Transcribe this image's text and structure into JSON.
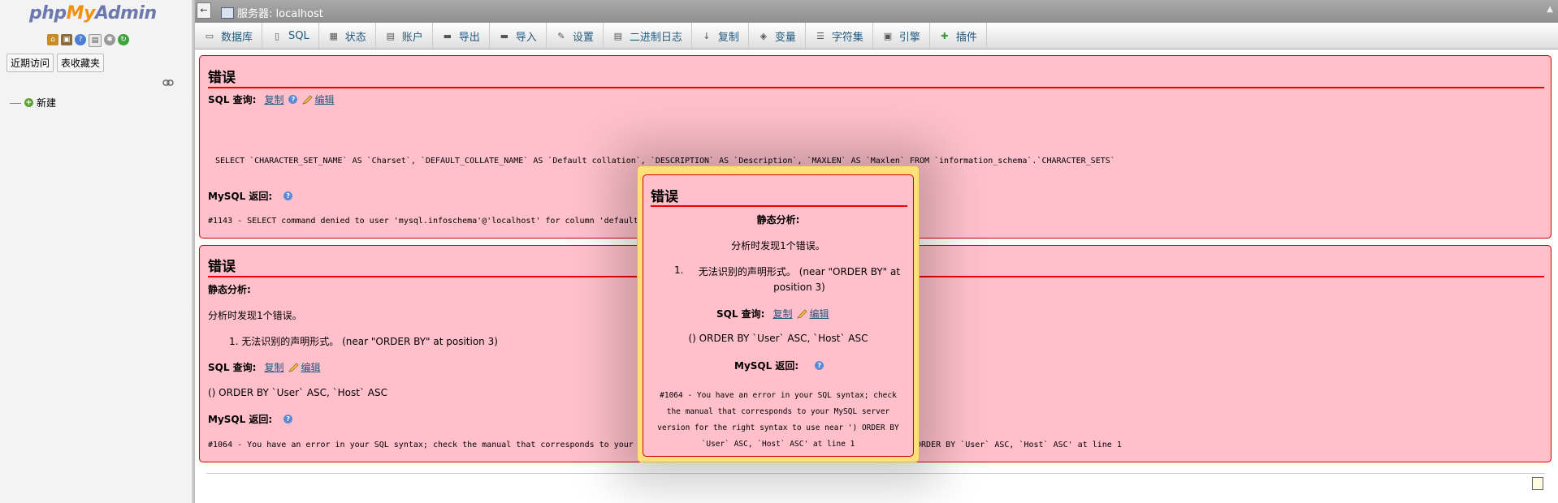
{
  "nav": {
    "logo": {
      "php": "php",
      "my": "My",
      "admin": "Admin"
    },
    "tabs": [
      "近期访问",
      "表收藏夹"
    ],
    "new_label": "新建"
  },
  "topbar": {
    "title": "服务器: localhost"
  },
  "menu": [
    {
      "label": "数据库",
      "icon": "database-icon"
    },
    {
      "label": "SQL",
      "icon": "sql-icon"
    },
    {
      "label": "状态",
      "icon": "status-icon"
    },
    {
      "label": "账户",
      "icon": "accounts-icon"
    },
    {
      "label": "导出",
      "icon": "export-icon"
    },
    {
      "label": "导入",
      "icon": "import-icon"
    },
    {
      "label": "设置",
      "icon": "settings-icon"
    },
    {
      "label": "二进制日志",
      "icon": "binlog-icon"
    },
    {
      "label": "复制",
      "icon": "replication-icon"
    },
    {
      "label": "变量",
      "icon": "variables-icon"
    },
    {
      "label": "字符集",
      "icon": "charset-icon"
    },
    {
      "label": "引擎",
      "icon": "engine-icon"
    },
    {
      "label": "插件",
      "icon": "plugin-icon"
    }
  ],
  "error1": {
    "title": "错误",
    "sql_label": "SQL 查询:",
    "copy": "复制",
    "edit": "编辑",
    "query": "SELECT `CHARACTER_SET_NAME` AS `Charset`, `DEFAULT_COLLATE_NAME` AS `Default collation`, `DESCRIPTION` AS `Description`, `MAXLEN` AS `Maxlen` FROM `information_schema`.`CHARACTER_SETS`",
    "mysql_label": "MySQL 返回:",
    "message": "#1143 - SELECT command denied to user 'mysql.infoschema'@'localhost' for column 'default"
  },
  "error2": {
    "title": "错误",
    "static_label": "静态分析:",
    "found": "分析时发现1个错误。",
    "item": "1. 无法识别的声明形式。 (near \"ORDER BY\" at position 3)",
    "sql_label": "SQL 查询:",
    "copy": "复制",
    "edit": "编辑",
    "query": "() ORDER BY `User` ASC, `Host` ASC",
    "mysql_label": "MySQL 返回:",
    "message_left": "#1064 - You have an error in your SQL syntax; check the manual that corresponds to your",
    "message_right": "ORDER BY `User` ASC, `Host` ASC' at line 1"
  },
  "popup": {
    "title": "错误",
    "static_label": "静态分析:",
    "found": "分析时发现1个错误。",
    "item_num": "1.",
    "item_text_1": "无法识别的声明形式。 (near \"ORDER BY\" at",
    "item_text_2": "position 3)",
    "sql_label": "SQL 查询:",
    "copy": "复制",
    "edit": "编辑",
    "query": "() ORDER BY `User` ASC, `Host` ASC",
    "mysql_label": "MySQL 返回:",
    "message_lines": [
      "#1064 - You have an error in your SQL syntax; check",
      "the manual that corresponds to your MySQL server",
      "version for the right syntax to use near ') ORDER BY",
      "`User` ASC, `Host` ASC' at line 1"
    ]
  }
}
